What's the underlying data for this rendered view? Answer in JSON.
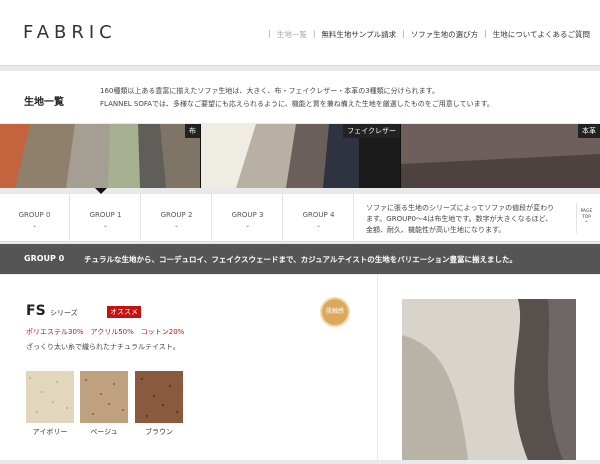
{
  "header": {
    "logo": "FABRIC",
    "nav": [
      {
        "label": "生地一覧",
        "current": true
      },
      {
        "label": "無料生地サンプル請求",
        "current": false
      },
      {
        "label": "ソファ生地の選び方",
        "current": false
      },
      {
        "label": "生地についてよくあるご質問",
        "current": false
      }
    ]
  },
  "intro": {
    "title": "生地一覧",
    "line1": "160種類以上ある豊富に揃えたソファ生地は、大きく、布・フェイクレザー・本革の3種類に分けられます。",
    "line2": "FLANNEL SOFAでは、多様なご要望にも応えられるように、機能と質を兼ね備えた生地を厳選したものをご用意しています。"
  },
  "categories": [
    {
      "label": "布"
    },
    {
      "label": "フェイクレザー"
    },
    {
      "label": "本革"
    }
  ],
  "groups": {
    "tabs": [
      {
        "label": "GROUP 0",
        "chevron": "⌄"
      },
      {
        "label": "GROUP 1",
        "chevron": "⌄"
      },
      {
        "label": "GROUP 2",
        "chevron": "⌄"
      },
      {
        "label": "GROUP 3",
        "chevron": "⌄"
      },
      {
        "label": "GROUP 4",
        "chevron": "⌄"
      }
    ],
    "desc1": "ソファに張る生地のシリーズによってソファの値段が変わり",
    "desc2": "ます。GROUP0～4は布生地です。数字が大きくなるほど、",
    "desc3": "金額、耐久、機能性が高い生地になります。",
    "pagetop_1": "PAGE",
    "pagetop_2": "TOP",
    "pagetop_3": "^"
  },
  "group_bar": {
    "label": "GROUP 0",
    "description": "チュラルな生地から、コーデュロイ、フェイクスウェードまで、カジュアルテイストの生地をバリエーション豊富に揃えました。"
  },
  "product": {
    "name": "FS",
    "series": "シリーズ",
    "recommend": "オススメ",
    "fibers": "ポリエステル30%　アクリル50%　コットン20%",
    "description": "ざっくり太い糸で織られたナチュラルテイスト。",
    "badge": "肌触感",
    "swatches": [
      {
        "label": "アイボリー",
        "color": "#e2d6bd"
      },
      {
        "label": "ベージュ",
        "color": "#bfa17f"
      },
      {
        "label": "ブラウン",
        "color": "#8a5a3f"
      }
    ]
  },
  "colors": {
    "accent_red": "#c4130f",
    "bar_gray": "#555555"
  }
}
